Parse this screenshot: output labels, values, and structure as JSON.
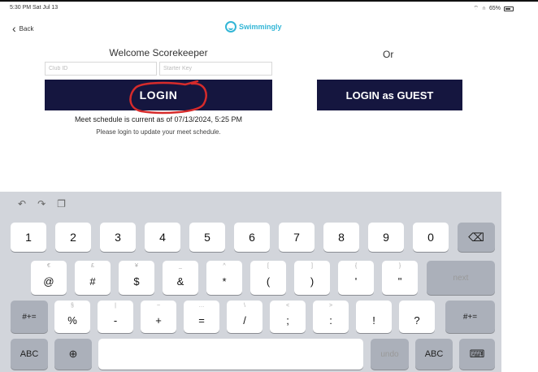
{
  "status_bar": {
    "time_date": "5:30 PM  Sat Jul 13",
    "battery": "65%"
  },
  "nav": {
    "back_label": "Back"
  },
  "brand": {
    "name": "Swimmingly"
  },
  "login": {
    "welcome": "Welcome Scorekeeper",
    "or_label": "Or",
    "club_id_placeholder": "Club ID",
    "starter_key_placeholder": "Starter Key",
    "login_label": "LOGIN",
    "guest_label": "LOGIN as GUEST",
    "schedule_status": "Meet schedule is current as of 07/13/2024, 5:25 PM",
    "schedule_hint": "Please login to update your meet schedule."
  },
  "keyboard": {
    "number_row": [
      "1",
      "2",
      "3",
      "4",
      "5",
      "6",
      "7",
      "8",
      "9",
      "0"
    ],
    "row2": [
      {
        "top": "€",
        "main": "@"
      },
      {
        "top": "£",
        "main": "#"
      },
      {
        "top": "¥",
        "main": "$"
      },
      {
        "top": "_",
        "main": "&"
      },
      {
        "top": "^",
        "main": "*"
      },
      {
        "top": "[",
        "main": "("
      },
      {
        "top": "]",
        "main": ")"
      },
      {
        "top": "{",
        "main": "'"
      },
      {
        "top": "}",
        "main": "\""
      }
    ],
    "row3": [
      {
        "top": "§",
        "main": "%"
      },
      {
        "top": "|",
        "main": "-"
      },
      {
        "top": "~",
        "main": "+"
      },
      {
        "top": "…",
        "main": "="
      },
      {
        "top": "\\",
        "main": "/"
      },
      {
        "top": "<",
        "main": ";"
      },
      {
        "top": ">",
        "main": ":"
      },
      {
        "top": "",
        "main": "!"
      },
      {
        "top": "",
        "main": "?"
      }
    ],
    "next_label": "next",
    "symbols_label": "#+=",
    "abc_label": "ABC",
    "undo_label": "undo"
  }
}
